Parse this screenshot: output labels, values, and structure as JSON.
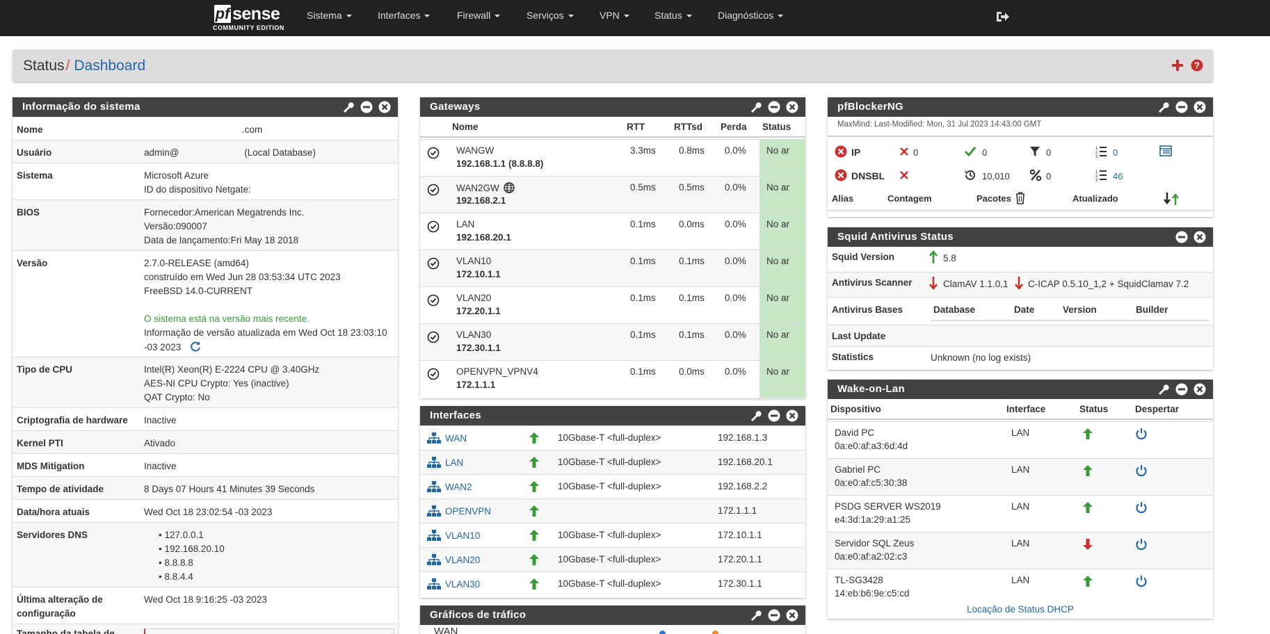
{
  "nav": {
    "logo_pf": "pf",
    "logo_sense": "sense",
    "logo_edition": "COMMUNITY EDITION",
    "menu": [
      "Sistema",
      "Interfaces",
      "Firewall",
      "Serviços",
      "VPN",
      "Status",
      "Diagnósticos"
    ]
  },
  "breadcrumb": {
    "section": "Status",
    "separator": "/",
    "page": "Dashboard"
  },
  "sysinfo": {
    "title": "Informação do sistema",
    "rows": [
      {
        "key": "Nome",
        "lines": [
          ".com"
        ]
      },
      {
        "key": "Usuário",
        "lines": [
          "admin@                         (Local Database)"
        ]
      },
      {
        "key": "Sistema",
        "lines": [
          "Microsoft Azure",
          "ID do dispositivo Netgate:"
        ]
      },
      {
        "key": "BIOS",
        "lines": [
          "Fornecedor:American Megatrends Inc.",
          "Versão:090007",
          "Data de lançamento:Fri May 18 2018"
        ]
      },
      {
        "key": "Versão",
        "lines": [
          "2.7.0-RELEASE (amd64)",
          "construído em Wed Jun 28 03:53:34 UTC 2023",
          "FreeBSD 14.0-CURRENT",
          "",
          "O sistema está na versão mais recente.",
          "Informação de versão atualizada em Wed Oct 18 23:03:10",
          "-03 2023"
        ]
      },
      {
        "key": "Tipo de CPU",
        "lines": [
          "Intel(R) Xeon(R) E-2224 CPU @ 3.40GHz",
          "AES-NI CPU Crypto: Yes (inactive)",
          "QAT Crypto: No"
        ]
      },
      {
        "key": "Criptografia de hardware",
        "lines": [
          "Inactive"
        ]
      },
      {
        "key": "Kernel PTI",
        "lines": [
          "Ativado"
        ]
      },
      {
        "key": "MDS Mitigation",
        "lines": [
          "Inactive"
        ]
      },
      {
        "key": "Tempo de atividade",
        "lines": [
          "8 Days 07 Hours 41 Minutes 39 Seconds"
        ]
      },
      {
        "key": "Data/hora atuais",
        "lines": [
          "Wed Oct 18 23:02:54 -03 2023"
        ]
      },
      {
        "key": "Servidores DNS",
        "lines": [
          "127.0.0.1",
          "192.168.20.10",
          "8.8.8.8",
          "8.8.4.4"
        ]
      },
      {
        "key": "Última alteração de configuração",
        "lines": [
          "Wed Oct 18 9:16:25 -03 2023"
        ]
      },
      {
        "key": "Tamanho da tabela de",
        "lines": [
          ""
        ]
      }
    ]
  },
  "gateways": {
    "title": "Gateways",
    "headers": [
      "Nome",
      "RTT",
      "RTTsd",
      "Perda",
      "Status"
    ],
    "rows": [
      {
        "name": "WANGW",
        "ip": "192.168.1.1 (8.8.8.8)",
        "rtt": "3.3ms",
        "rttsd": "0.8ms",
        "loss": "0.0%",
        "status": "No ar"
      },
      {
        "name": "WAN2GW",
        "ip": "192.168.2.1",
        "rtt": "0.5ms",
        "rttsd": "0.5ms",
        "loss": "0.0%",
        "status": "No ar"
      },
      {
        "name": "LAN",
        "ip": "192.168.20.1",
        "rtt": "0.1ms",
        "rttsd": "0.0ms",
        "loss": "0.0%",
        "status": "No ar"
      },
      {
        "name": "VLAN10",
        "ip": "172.10.1.1",
        "rtt": "0.1ms",
        "rttsd": "0.1ms",
        "loss": "0.0%",
        "status": "No ar"
      },
      {
        "name": "VLAN20",
        "ip": "172.20.1.1",
        "rtt": "0.1ms",
        "rttsd": "0.1ms",
        "loss": "0.0%",
        "status": "No ar"
      },
      {
        "name": "VLAN30",
        "ip": "172.30.1.1",
        "rtt": "0.1ms",
        "rttsd": "0.1ms",
        "loss": "0.0%",
        "status": "No ar"
      },
      {
        "name": "OPENVPN_VPNV4",
        "ip": "172.1.1.1",
        "rtt": "0.1ms",
        "rttsd": "0.0ms",
        "loss": "0.0%",
        "status": "No ar"
      }
    ]
  },
  "interfaces": {
    "title": "Interfaces",
    "rows": [
      {
        "name": "WAN",
        "media": "10Gbase-T <full-duplex>",
        "ip": "192.168.1.3"
      },
      {
        "name": "LAN",
        "media": "10Gbase-T <full-duplex>",
        "ip": "192.168.20.1"
      },
      {
        "name": "WAN2",
        "media": "10Gbase-T <full-duplex>",
        "ip": "192.168.2.2"
      },
      {
        "name": "OPENVPN",
        "media": "",
        "ip": "172.1.1.1"
      },
      {
        "name": "VLAN10",
        "media": "10Gbase-T <full-duplex>",
        "ip": "172.10.1.1"
      },
      {
        "name": "VLAN20",
        "media": "10Gbase-T <full-duplex>",
        "ip": "172.20.1.1"
      },
      {
        "name": "VLAN30",
        "media": "10Gbase-T <full-duplex>",
        "ip": "172.30.1.1"
      }
    ]
  },
  "traffic": {
    "title": "Gráficos de tráfico",
    "label": "WAN"
  },
  "pfblocker": {
    "title": "pfBlockerNG",
    "maxmind": "MaxMind: Last-Modified: Mon, 31 Jul 2023 14:43:00 GMT",
    "ip_label": "IP",
    "dnsbl_label": "DNSBL",
    "ip_counts": [
      "0",
      "0",
      "0",
      "0"
    ],
    "dnsbl_counts": [
      "10,010",
      "0",
      "46"
    ],
    "headers": [
      "Alias",
      "Contagem",
      "Pacotes",
      "Atualizado"
    ]
  },
  "squid": {
    "title": "Squid Antivirus Status",
    "version_label": "Squid Version",
    "version": "5.8",
    "scanner_label": "Antivirus Scanner",
    "scanner_clamav": "ClamAV 1.1.0,1",
    "scanner_icap": "C-ICAP 0.5.10_1,2 +  SquidClamav 7.2",
    "bases_label": "Antivirus Bases",
    "bases_headers": [
      "Database",
      "Date",
      "Version",
      "Builder"
    ],
    "last_update_label": "Last Update",
    "statistics_label": "Statistics",
    "statistics": "Unknown (no log exists)"
  },
  "wol": {
    "title": "Wake-on-Lan",
    "headers": [
      "Dispositivo",
      "Interface",
      "Status",
      "Despertar"
    ],
    "rows": [
      {
        "name": "David PC",
        "mac": "0a:e0:af:a3:6d:4d",
        "iface": "LAN",
        "up": true
      },
      {
        "name": "Gabriel PC",
        "mac": "0a:e0:af:c5:30:38",
        "iface": "LAN",
        "up": true
      },
      {
        "name": "PSDG SERVER WS2019",
        "mac": "e4:3d:1a:29:a1:25",
        "iface": "LAN",
        "up": true
      },
      {
        "name": "Servidor SQL Zeus",
        "mac": "0a:e0:af:a2:02:c3",
        "iface": "LAN",
        "up": false
      },
      {
        "name": "TL-SG3428",
        "mac": "14:eb:b6:9e:c5:cd",
        "iface": "LAN",
        "up": true
      }
    ],
    "footer_link": "Locação de Status DHCP"
  },
  "colors": {
    "navbar": "#212121",
    "panel_head": "#424242",
    "link": "#2266aa",
    "status_ok": "#c6e6c6",
    "up_arrow": "#3a9a3a",
    "down_arrow": "#c9302c",
    "accent_red": "#d9534f"
  }
}
